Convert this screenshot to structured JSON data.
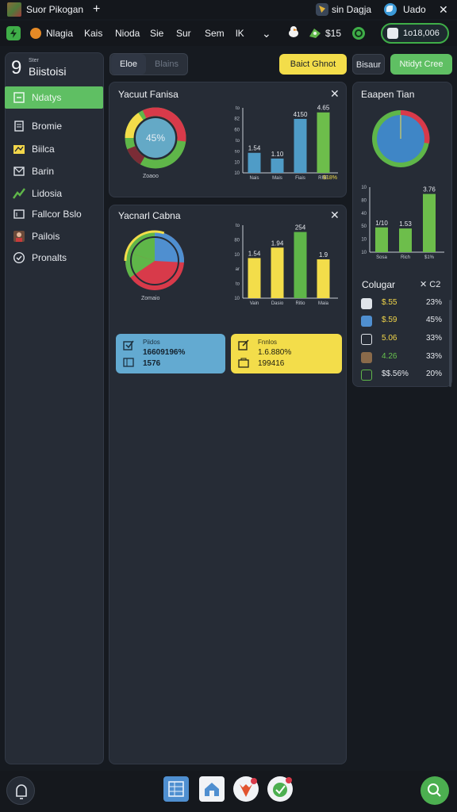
{
  "window": {
    "title": "Suor Pikogan",
    "new_tab": "+",
    "user": "sin Dagja",
    "account": "Uado",
    "close": "✕"
  },
  "nav": {
    "items": [
      "Nlagia",
      "Kais",
      "Nioda",
      "Sie",
      "Sur",
      "Sem",
      "lK"
    ],
    "chevron": "⌄",
    "balance": "$15",
    "counter": "1o18,006"
  },
  "sidebar": {
    "number": "9",
    "subtitle": "Ster",
    "title": "Biistoisi",
    "items": [
      {
        "label": "Ndatys",
        "icon": "square-icon",
        "active": true
      },
      {
        "label": "Bromie",
        "icon": "document-icon"
      },
      {
        "label": "Biilca",
        "icon": "folder-icon"
      },
      {
        "label": "Barin",
        "icon": "mail-icon"
      },
      {
        "label": "Lidosia",
        "icon": "chart-icon"
      },
      {
        "label": "Fallcor Bslo",
        "icon": "card-icon"
      },
      {
        "label": "Pailois",
        "icon": "avatar-icon"
      },
      {
        "label": "Pronalts",
        "icon": "check-circle-icon"
      }
    ]
  },
  "toolbar": {
    "tab_active": "Eloe",
    "tab_inactive": "Blains",
    "select_button": "Baict Ghnot",
    "secondary_button": "Bisaur",
    "create_button": "Ntidyt Cree"
  },
  "card1": {
    "title": "Yacuut Fanisa",
    "donut_center": "45%",
    "donut_label": "Zoaoo",
    "close": "✕"
  },
  "card2": {
    "title": "Yacnarl Cabna",
    "pie_label": "Zomaio",
    "close": "✕"
  },
  "card3": {
    "title": "Eaapen Tian"
  },
  "comparison": {
    "title": "Colugar",
    "close": "✕ C2",
    "rows": [
      {
        "a": "$.55",
        "b": "23%",
        "a_color": "#f2d64a",
        "icon": "clock-icon"
      },
      {
        "a": "$.59",
        "b": "45%",
        "a_color": "#f2d64a",
        "icon": "tag-icon"
      },
      {
        "a": "5.06",
        "b": "33%",
        "a_color": "#f2d64a",
        "icon": "arrow-icon"
      },
      {
        "a": "4.26",
        "b": "33%",
        "a_color": "#67c34d",
        "icon": "avatar-icon"
      },
      {
        "a": "$$.56%",
        "b": "20%",
        "a_color": "#e6e9ee",
        "icon": "receipt-icon"
      }
    ]
  },
  "info_cards": {
    "blue": {
      "heading": "Piidos",
      "line1": "16609196%",
      "line2": "1576"
    },
    "yellow": {
      "heading": "Fnnlos",
      "line1": "1.6.880%",
      "line2": "199416"
    }
  },
  "chart_data": [
    {
      "type": "bar",
      "categories": [
        "Nais",
        "Mais",
        "Fiais",
        "RRE"
      ],
      "values": [
        1.54,
        1.1,
        4.15,
        4.65
      ],
      "ticks": [
        "to",
        "82",
        "60",
        "to",
        "so",
        "10",
        "10"
      ],
      "bar_labels": [
        "1.54",
        "1.10",
        "4150",
        "4.65"
      ],
      "bottom_value": "$18%",
      "colors": [
        "#4f9cc7",
        "#4f9cc7",
        "#4f9cc7",
        "#6dbe4b"
      ]
    },
    {
      "type": "bar",
      "categories": [
        "Vain",
        "Dasio",
        "Ritio",
        "Maia"
      ],
      "values": [
        1.54,
        1.94,
        2.54,
        1.49
      ],
      "ticks": [
        "to",
        "80",
        "10",
        "ar",
        "to",
        "10"
      ],
      "bar_labels": [
        "1.54",
        "1.94",
        "254",
        "1.9"
      ],
      "colors": [
        "#f3dd4a",
        "#f3dd4a",
        "#5fb649",
        "#f3dd4a"
      ]
    },
    {
      "type": "bar",
      "categories": [
        "Sosa",
        "Rich",
        "$1%"
      ],
      "values": [
        1.6,
        1.53,
        3.76
      ],
      "ticks": [
        "10",
        "80",
        "40",
        "50",
        "10",
        "10"
      ],
      "bar_labels": [
        "1/10",
        "1.53",
        "3.76"
      ],
      "colors": [
        "#6dbe4b",
        "#6dbe4b",
        "#6dbe4b"
      ]
    },
    {
      "type": "pie",
      "label": "45%",
      "slices": [
        {
          "value": 35,
          "color": "#5fb649"
        },
        {
          "value": 25,
          "color": "#d83a4a"
        },
        {
          "value": 15,
          "color": "#f3dd4a"
        },
        {
          "value": 25,
          "color": "#6dbe4b"
        }
      ]
    }
  ]
}
